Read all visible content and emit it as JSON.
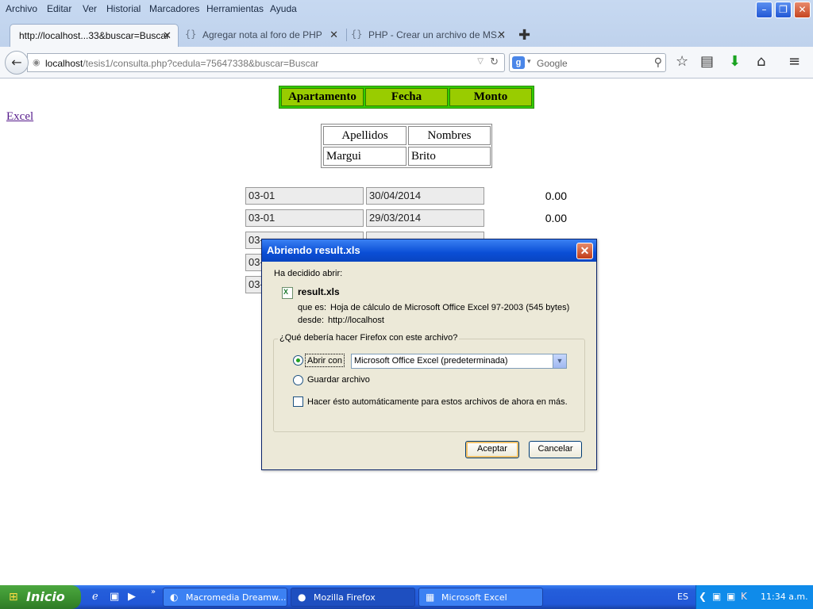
{
  "menubar": [
    "Archivo",
    "Editar",
    "Ver",
    "Historial",
    "Marcadores",
    "Herramientas",
    "Ayuda"
  ],
  "tabs": [
    {
      "title": "http://localhost...33&buscar=Buscar",
      "active": true
    },
    {
      "title": "Agregar nota al foro de PHP",
      "active": false
    },
    {
      "title": "PHP - Crear un archivo de MS...",
      "active": false
    }
  ],
  "urlbar": {
    "host": "localhost",
    "path": "/tesis1/consulta.php?cedula=75647338&buscar=Buscar"
  },
  "search": {
    "engine_icon": "g-icon",
    "placeholder": "Google"
  },
  "page": {
    "header_columns": [
      "Apartamento",
      "Fecha",
      "Monto"
    ],
    "excel_link": "Excel",
    "person": {
      "headers": [
        "Apellidos",
        "Nombres"
      ],
      "values": [
        "Margui",
        "Brito"
      ]
    },
    "ledger": [
      {
        "apartamento": "03-01",
        "fecha": "30/04/2014",
        "monto": "0.00"
      },
      {
        "apartamento": "03-01",
        "fecha": "29/03/2014",
        "monto": "0.00"
      },
      {
        "apartamento": "03-",
        "fecha": "",
        "monto": ""
      },
      {
        "apartamento": "03-",
        "fecha": "",
        "monto": ""
      },
      {
        "apartamento": "03-",
        "fecha": "",
        "monto": ""
      }
    ]
  },
  "dialog": {
    "title": "Abriendo result.xls",
    "intro": "Ha decidido abrir:",
    "filename": "result.xls",
    "type_label": "que es:",
    "type_value": "Hoja de cálculo de Microsoft Office Excel 97-2003 (545 bytes)",
    "from_label": "desde:",
    "from_value": "http://localhost",
    "question": "¿Qué debería hacer Firefox con este archivo?",
    "open_with_label": "Abrir con",
    "open_with_value": "Microsoft Office Excel (predeterminada)",
    "save_label": "Guardar archivo",
    "auto_label": "Hacer ésto automáticamente para estos archivos de ahora en más.",
    "selected_option": "open_with",
    "auto_checked": false,
    "ok_label": "Aceptar",
    "cancel_label": "Cancelar"
  },
  "taskbar": {
    "start_label": "Inicio",
    "tasks": [
      {
        "label": "Macromedia Dreamw...",
        "active": false
      },
      {
        "label": "Mozilla Firefox",
        "active": true
      },
      {
        "label": "Microsoft Excel",
        "active": false
      }
    ],
    "language": "ES",
    "clock": "11:34 a.m."
  },
  "colors": {
    "header_bg": "#99cc00",
    "header_border": "#33cc00",
    "titlebar": "#0a4ed6",
    "dialog_bg": "#ece9d8"
  }
}
